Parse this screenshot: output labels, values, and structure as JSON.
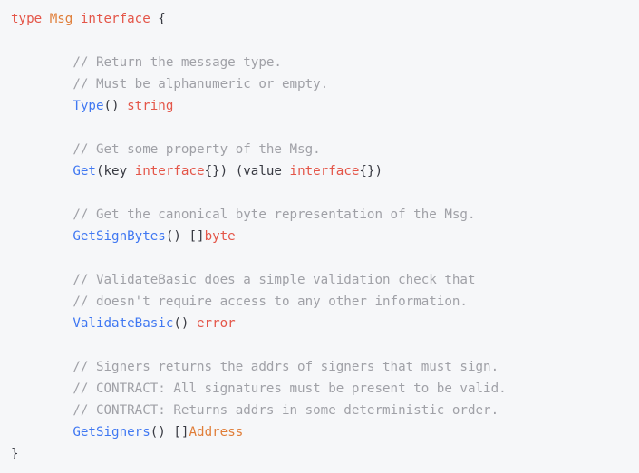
{
  "editor": {
    "language": "go",
    "theme": "one-light",
    "background": "#f6f7f9",
    "font_size_px": 14,
    "indent": "        "
  },
  "colors": {
    "plain": "#383a42",
    "keyword": "#e45649",
    "type": "#e07e39",
    "function": "#4078f2",
    "comment": "#a0a1a7",
    "punctuation": "#383a42",
    "background": "#f6f7f9"
  },
  "code": {
    "lines": [
      {
        "index": 1,
        "text": "type Msg interface {",
        "tokens": [
          {
            "t": "type",
            "c": "keyword"
          },
          {
            "t": " ",
            "c": "plain"
          },
          {
            "t": "Msg",
            "c": "type"
          },
          {
            "t": " ",
            "c": "plain"
          },
          {
            "t": "interface",
            "c": "keyword"
          },
          {
            "t": " {",
            "c": "punct"
          }
        ]
      },
      {
        "index": 2,
        "text": "",
        "tokens": []
      },
      {
        "index": 3,
        "text": "        // Return the message type.",
        "tokens": [
          {
            "t": "        ",
            "c": "plain"
          },
          {
            "t": "// Return the message type.",
            "c": "comment"
          }
        ]
      },
      {
        "index": 4,
        "text": "        // Must be alphanumeric or empty.",
        "tokens": [
          {
            "t": "        ",
            "c": "plain"
          },
          {
            "t": "// Must be alphanumeric or empty.",
            "c": "comment"
          }
        ]
      },
      {
        "index": 5,
        "text": "        Type() string",
        "tokens": [
          {
            "t": "        ",
            "c": "plain"
          },
          {
            "t": "Type",
            "c": "func"
          },
          {
            "t": "() ",
            "c": "punct"
          },
          {
            "t": "string",
            "c": "keyword"
          }
        ]
      },
      {
        "index": 6,
        "text": "",
        "tokens": []
      },
      {
        "index": 7,
        "text": "        // Get some property of the Msg.",
        "tokens": [
          {
            "t": "        ",
            "c": "plain"
          },
          {
            "t": "// Get some property of the Msg.",
            "c": "comment"
          }
        ]
      },
      {
        "index": 8,
        "text": "        Get(key interface{}) (value interface{})",
        "tokens": [
          {
            "t": "        ",
            "c": "plain"
          },
          {
            "t": "Get",
            "c": "func"
          },
          {
            "t": "(key ",
            "c": "punct"
          },
          {
            "t": "interface",
            "c": "keyword"
          },
          {
            "t": "{}) (value ",
            "c": "punct"
          },
          {
            "t": "interface",
            "c": "keyword"
          },
          {
            "t": "{})",
            "c": "punct"
          }
        ]
      },
      {
        "index": 9,
        "text": "",
        "tokens": []
      },
      {
        "index": 10,
        "text": "        // Get the canonical byte representation of the Msg.",
        "tokens": [
          {
            "t": "        ",
            "c": "plain"
          },
          {
            "t": "// Get the canonical byte representation of the Msg.",
            "c": "comment"
          }
        ]
      },
      {
        "index": 11,
        "text": "        GetSignBytes() []byte",
        "tokens": [
          {
            "t": "        ",
            "c": "plain"
          },
          {
            "t": "GetSignBytes",
            "c": "func"
          },
          {
            "t": "() []",
            "c": "punct"
          },
          {
            "t": "byte",
            "c": "keyword"
          }
        ]
      },
      {
        "index": 12,
        "text": "",
        "tokens": []
      },
      {
        "index": 13,
        "text": "        // ValidateBasic does a simple validation check that",
        "tokens": [
          {
            "t": "        ",
            "c": "plain"
          },
          {
            "t": "// ValidateBasic does a simple validation check that",
            "c": "comment"
          }
        ]
      },
      {
        "index": 14,
        "text": "        // doesn't require access to any other information.",
        "tokens": [
          {
            "t": "        ",
            "c": "plain"
          },
          {
            "t": "// doesn't require access to any other information.",
            "c": "comment"
          }
        ]
      },
      {
        "index": 15,
        "text": "        ValidateBasic() error",
        "tokens": [
          {
            "t": "        ",
            "c": "plain"
          },
          {
            "t": "ValidateBasic",
            "c": "func"
          },
          {
            "t": "() ",
            "c": "punct"
          },
          {
            "t": "error",
            "c": "keyword"
          }
        ]
      },
      {
        "index": 16,
        "text": "",
        "tokens": []
      },
      {
        "index": 17,
        "text": "        // Signers returns the addrs of signers that must sign.",
        "tokens": [
          {
            "t": "        ",
            "c": "plain"
          },
          {
            "t": "// Signers returns the addrs of signers that must sign.",
            "c": "comment"
          }
        ]
      },
      {
        "index": 18,
        "text": "        // CONTRACT: All signatures must be present to be valid.",
        "tokens": [
          {
            "t": "        ",
            "c": "plain"
          },
          {
            "t": "// CONTRACT: All signatures must be present to be valid.",
            "c": "comment"
          }
        ]
      },
      {
        "index": 19,
        "text": "        // CONTRACT: Returns addrs in some deterministic order.",
        "tokens": [
          {
            "t": "        ",
            "c": "plain"
          },
          {
            "t": "// CONTRACT: Returns addrs in some deterministic order.",
            "c": "comment"
          }
        ]
      },
      {
        "index": 20,
        "text": "        GetSigners() []Address",
        "tokens": [
          {
            "t": "        ",
            "c": "plain"
          },
          {
            "t": "GetSigners",
            "c": "func"
          },
          {
            "t": "() []",
            "c": "punct"
          },
          {
            "t": "Address",
            "c": "type"
          }
        ]
      },
      {
        "index": 21,
        "text": "}",
        "tokens": [
          {
            "t": "}",
            "c": "punct"
          }
        ]
      }
    ]
  }
}
